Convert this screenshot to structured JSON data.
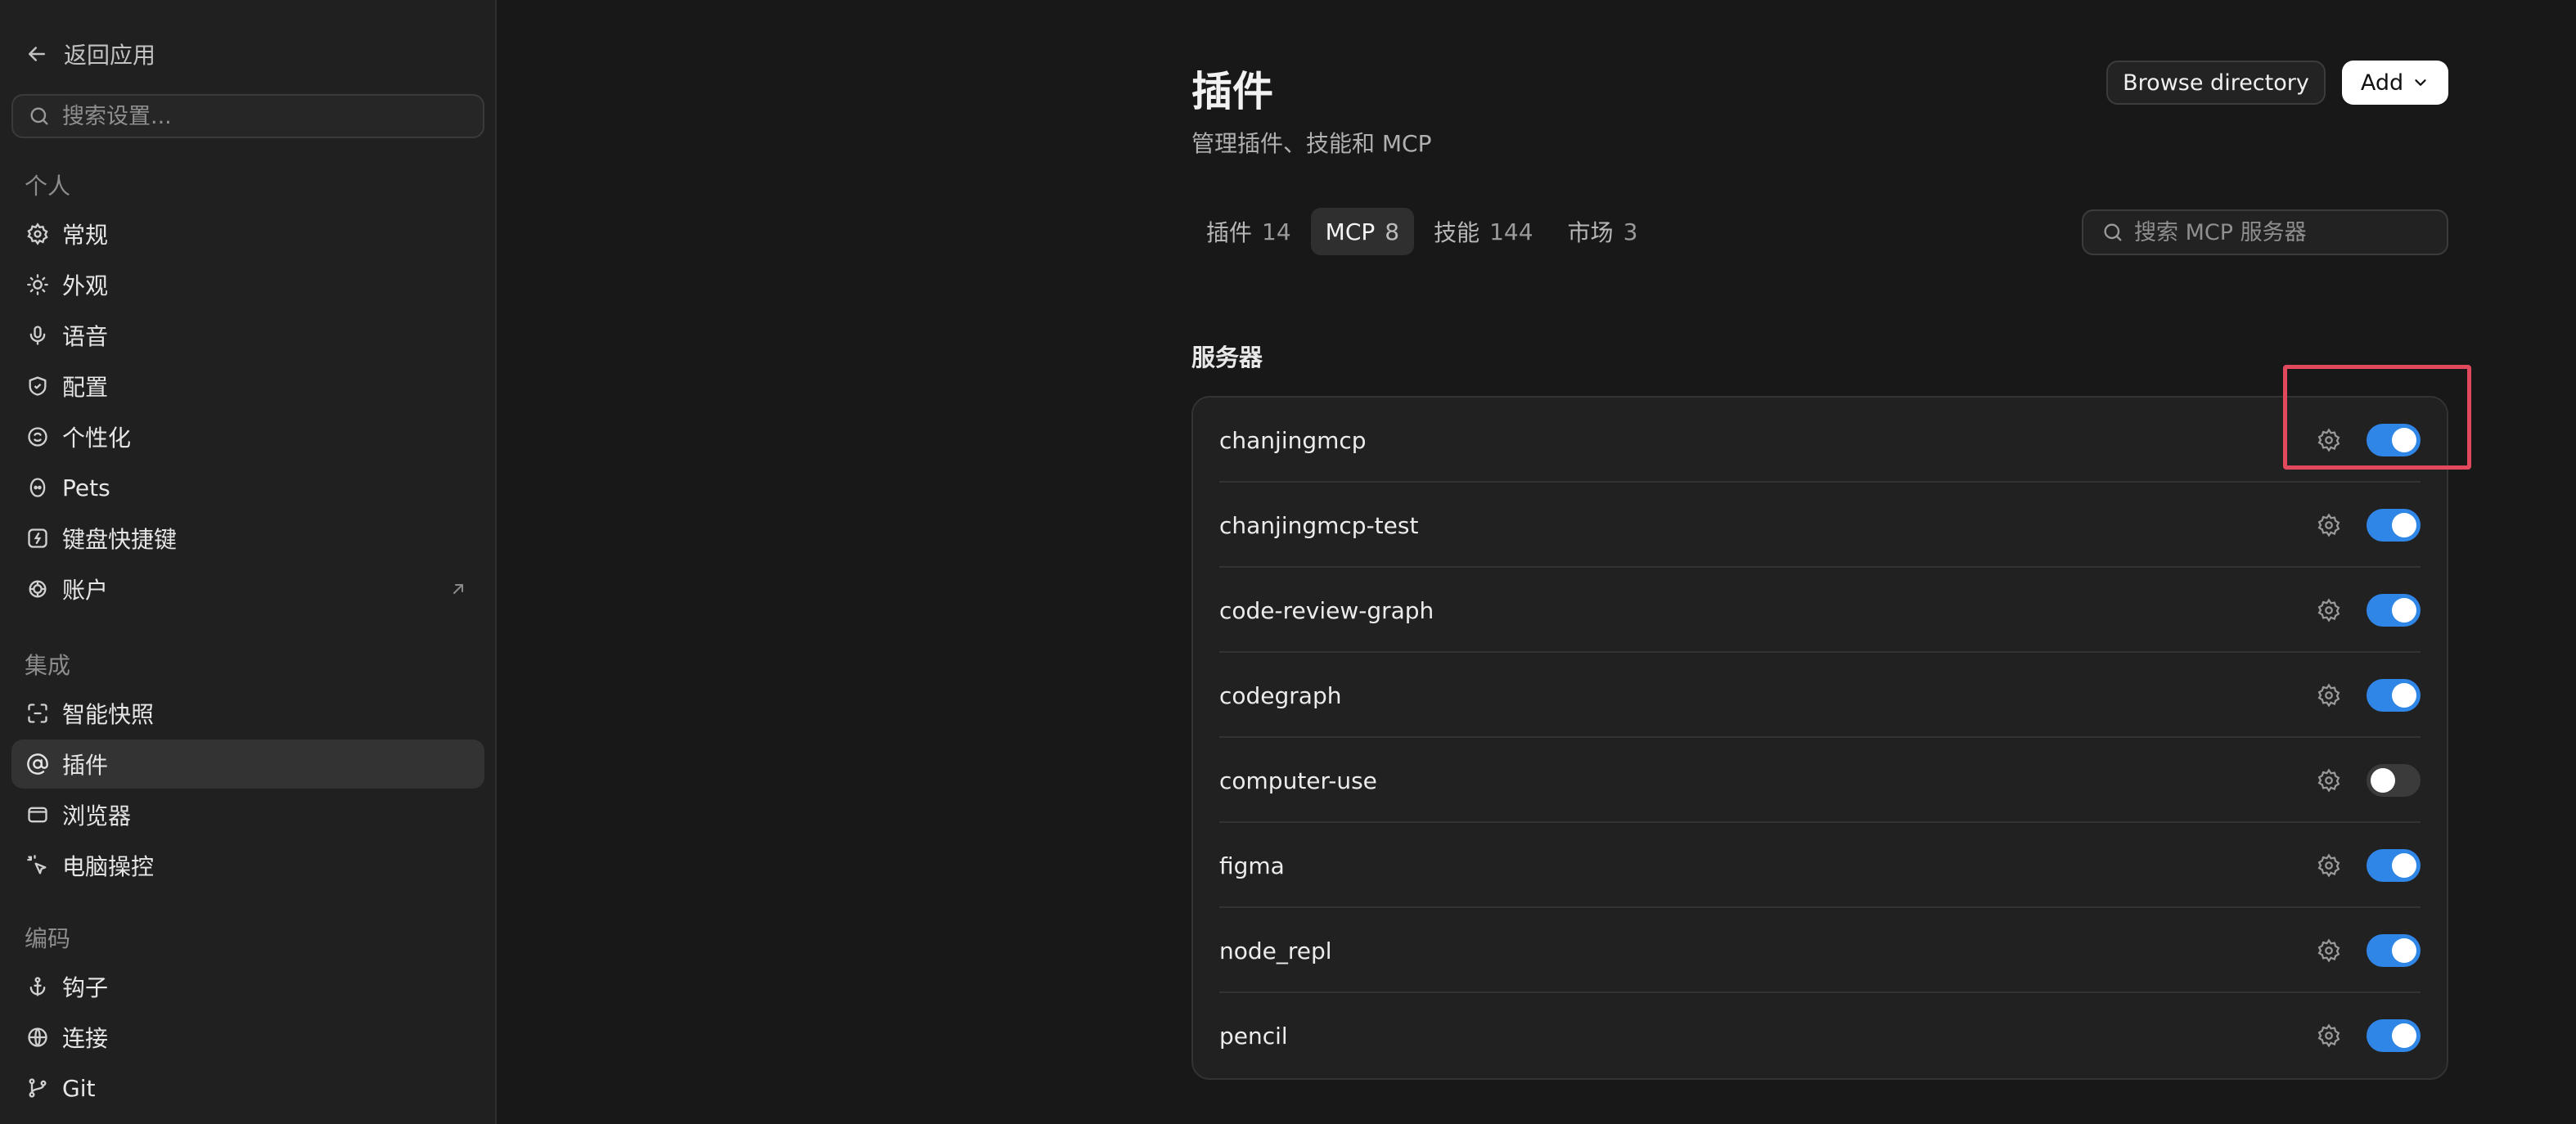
{
  "sidebar": {
    "back_label": "返回应用",
    "search_placeholder": "搜索设置...",
    "sections": {
      "personal": "个人",
      "integrations": "集成",
      "coding": "编码"
    },
    "items": [
      {
        "label": "常规",
        "icon": "gear-icon"
      },
      {
        "label": "外观",
        "icon": "sun-icon"
      },
      {
        "label": "语音",
        "icon": "microphone-icon"
      },
      {
        "label": "配置",
        "icon": "shield-icon"
      },
      {
        "label": "个性化",
        "icon": "personalization-icon"
      },
      {
        "label": "Pets",
        "icon": "pet-icon"
      },
      {
        "label": "键盘快捷键",
        "icon": "keyboard-shortcut-icon"
      },
      {
        "label": "账户",
        "icon": "account-icon"
      },
      {
        "label": "智能快照",
        "icon": "snapshot-icon"
      },
      {
        "label": "插件",
        "icon": "at-icon"
      },
      {
        "label": "浏览器",
        "icon": "browser-icon"
      },
      {
        "label": "电脑操控",
        "icon": "cursor-click-icon"
      },
      {
        "label": "钩子",
        "icon": "anchor-icon"
      },
      {
        "label": "连接",
        "icon": "globe-icon"
      },
      {
        "label": "Git",
        "icon": "git-branch-icon"
      }
    ],
    "active_item": "插件"
  },
  "header": {
    "title": "插件",
    "subtitle": "管理插件、技能和 MCP",
    "browse_label": "Browse directory",
    "add_label": "Add"
  },
  "tabs": [
    {
      "label": "插件",
      "count": "14"
    },
    {
      "label": "MCP",
      "count": "8"
    },
    {
      "label": "技能",
      "count": "144"
    },
    {
      "label": "市场",
      "count": "3"
    }
  ],
  "active_tab": "MCP",
  "mcp_search_placeholder": "搜索 MCP 服务器",
  "servers_heading": "服务器",
  "servers": [
    {
      "name": "chanjingmcp",
      "enabled": true
    },
    {
      "name": "chanjingmcp-test",
      "enabled": true
    },
    {
      "name": "code-review-graph",
      "enabled": true
    },
    {
      "name": "codegraph",
      "enabled": true
    },
    {
      "name": "computer-use",
      "enabled": false
    },
    {
      "name": "figma",
      "enabled": true
    },
    {
      "name": "node_repl",
      "enabled": true
    },
    {
      "name": "pencil",
      "enabled": true
    }
  ],
  "colors": {
    "accent": "#2f86e6",
    "highlight": "#e3495c",
    "background": "#181818",
    "sidebar": "#202020"
  }
}
